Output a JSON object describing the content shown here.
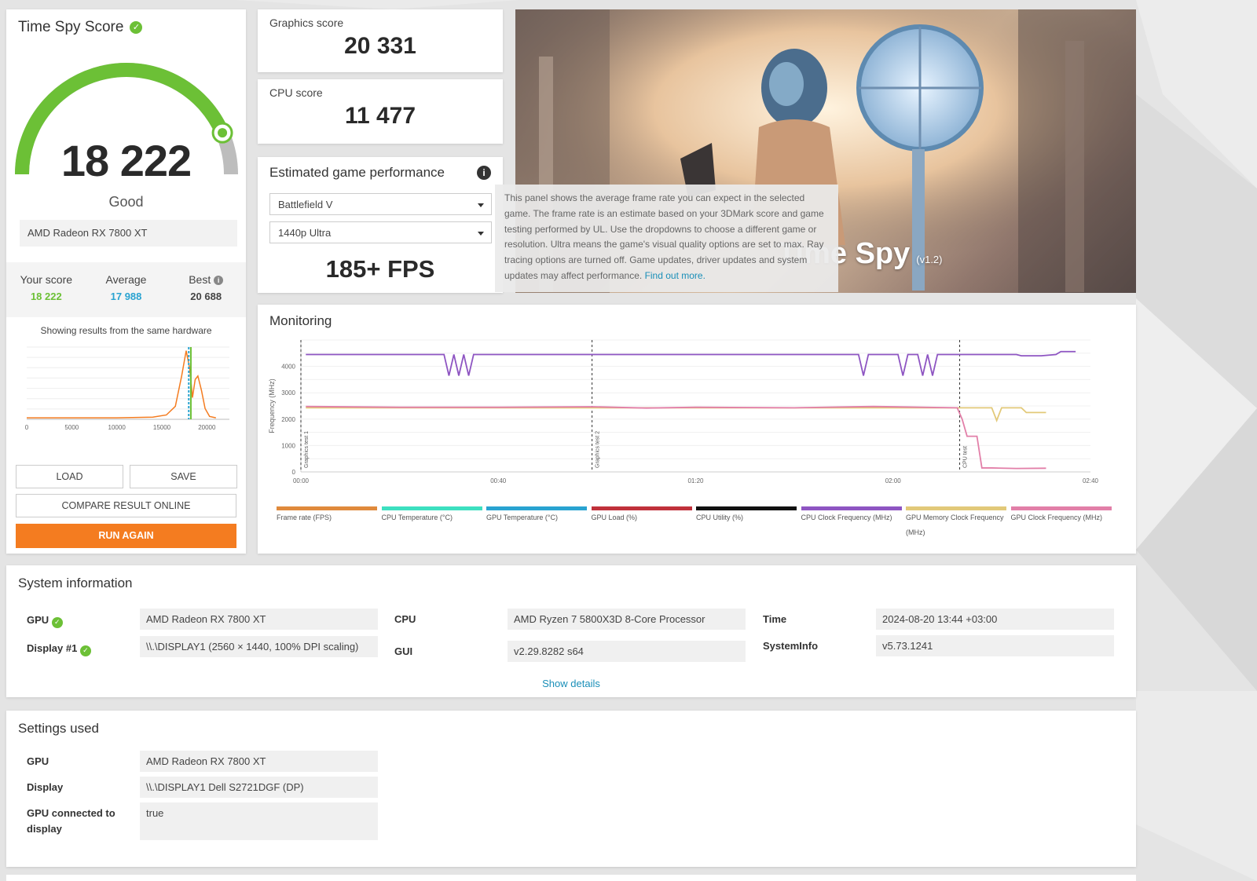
{
  "score_card": {
    "title": "Time Spy Score",
    "score": "18 222",
    "score_value": 18222,
    "rating": "Good",
    "gpu": "AMD Radeon RX 7800 XT",
    "your_score_label": "Your score",
    "your_score": "18 222",
    "average_label": "Average",
    "average": "17 988",
    "best_label": "Best",
    "best": "20 688",
    "showing_text": "Showing results from the same hardware",
    "colors": {
      "good_green": "#6cc036",
      "average_blue": "#29a3d1",
      "accent_orange": "#f47c20"
    }
  },
  "distribution_chart": {
    "type": "line",
    "x_ticks": [
      "0",
      "5000",
      "10000",
      "15000",
      "20000"
    ],
    "xlim": [
      0,
      22500
    ],
    "series": [
      {
        "color": "#f47c20",
        "points": [
          [
            0,
            0.02
          ],
          [
            5000,
            0.02
          ],
          [
            10000,
            0.02
          ],
          [
            14000,
            0.03
          ],
          [
            15500,
            0.06
          ],
          [
            16500,
            0.18
          ],
          [
            17200,
            0.6
          ],
          [
            17700,
            0.95
          ],
          [
            18100,
            0.7
          ],
          [
            18400,
            0.3
          ],
          [
            18700,
            0.55
          ],
          [
            19000,
            0.6
          ],
          [
            19400,
            0.4
          ],
          [
            19800,
            0.15
          ],
          [
            20300,
            0.04
          ],
          [
            21000,
            0.02
          ]
        ]
      }
    ],
    "markers": [
      {
        "x": 17988,
        "color": "#29a3d1",
        "style": "dashed"
      },
      {
        "x": 18222,
        "color": "#6cc036",
        "style": "solid"
      }
    ]
  },
  "buttons": {
    "load": "LOAD",
    "save": "SAVE",
    "compare": "COMPARE RESULT ONLINE",
    "run_again": "RUN AGAIN"
  },
  "graphics_score": {
    "label": "Graphics score",
    "value": "20 331"
  },
  "cpu_score": {
    "label": "CPU score",
    "value": "11 477"
  },
  "estimated_game_performance": {
    "title": "Estimated game performance",
    "game": "Battlefield V",
    "preset": "1440p Ultra",
    "fps": "185+ FPS"
  },
  "tooltip": {
    "text": "This panel shows the average frame rate you can expect in the selected game. The frame rate is an estimate based on your 3DMark score and game testing performed by UL. Use the dropdowns to choose a different game or resolution. Ultra means the game's visual quality options are set to max. Ray tracing options are turned off. Game updates, driver updates and system updates may affect performance.",
    "link": "Find out more."
  },
  "hero": {
    "title": "Time Spy",
    "version": "(v1.2)"
  },
  "monitoring": {
    "title": "Monitoring",
    "chart_data": {
      "type": "line",
      "ylabel": "Frequency (MHz)",
      "y_ticks": [
        "0",
        "1000",
        "2000",
        "3000",
        "4000"
      ],
      "ylim": [
        0,
        5000
      ],
      "x_ticks": [
        "00:00",
        "00:40",
        "01:20",
        "02:00",
        "02:40"
      ],
      "xlim": [
        0,
        160
      ],
      "test_markers": [
        {
          "x": 0,
          "label": "Graphics test 1"
        },
        {
          "x": 59,
          "label": "Graphics test 2"
        },
        {
          "x": 133.5,
          "label": "CPU test"
        }
      ],
      "series": [
        {
          "name": "CPU Clock Frequency (MHz)",
          "color": "#8e55c2",
          "points": [
            [
              1,
              4450
            ],
            [
              29,
              4450
            ],
            [
              30,
              3650
            ],
            [
              31,
              4450
            ],
            [
              32,
              3650
            ],
            [
              33,
              4450
            ],
            [
              34,
              3650
            ],
            [
              35,
              4450
            ],
            [
              37,
              4450
            ],
            [
              113,
              4450
            ],
            [
              114,
              3650
            ],
            [
              115,
              4450
            ],
            [
              121,
              4450
            ],
            [
              122,
              3650
            ],
            [
              123,
              4450
            ],
            [
              125,
              4450
            ],
            [
              126,
              3650
            ],
            [
              127,
              4450
            ],
            [
              128,
              3650
            ],
            [
              129,
              4450
            ],
            [
              145,
              4450
            ],
            [
              146,
              4400
            ],
            [
              150,
              4400
            ],
            [
              153,
              4450
            ],
            [
              154,
              4560
            ],
            [
              157,
              4560
            ]
          ]
        },
        {
          "name": "GPU Memory Clock Frequency (MHz)",
          "color": "#e2c979",
          "points": [
            [
              1,
              2430
            ],
            [
              133,
              2430
            ],
            [
              140,
              2430
            ],
            [
              141,
              1950
            ],
            [
              142,
              2430
            ],
            [
              146,
              2430
            ],
            [
              147,
              2250
            ],
            [
              151,
              2250
            ]
          ]
        },
        {
          "name": "GPU Clock Frequency (MHz)",
          "color": "#e27fa8",
          "points": [
            [
              1,
              2480
            ],
            [
              20,
              2450
            ],
            [
              40,
              2450
            ],
            [
              59,
              2470
            ],
            [
              70,
              2420
            ],
            [
              80,
              2450
            ],
            [
              100,
              2430
            ],
            [
              116,
              2480
            ],
            [
              133,
              2430
            ],
            [
              134,
              2000
            ],
            [
              135,
              1350
            ],
            [
              137,
              1350
            ],
            [
              138,
              150
            ],
            [
              140,
              150
            ],
            [
              145,
              130
            ],
            [
              151,
              140
            ]
          ]
        }
      ]
    },
    "legend": [
      {
        "label": "Frame rate (FPS)",
        "color": "#e08a3c"
      },
      {
        "label": "CPU Temperature (°C)",
        "color": "#3de0c0"
      },
      {
        "label": "GPU Temperature (°C)",
        "color": "#29a3d1"
      },
      {
        "label": "GPU Load (%)",
        "color": "#c0313b"
      },
      {
        "label": "CPU Utility (%)",
        "color": "#111111"
      },
      {
        "label": "CPU Clock Frequency (MHz)",
        "color": "#8e55c2"
      },
      {
        "label": "GPU Memory Clock Frequency (MHz)",
        "color": "#e2c979"
      },
      {
        "label": "GPU Clock Frequency (MHz)",
        "color": "#e27fa8"
      }
    ]
  },
  "system_information": {
    "title": "System information",
    "gpu_label": "GPU",
    "gpu": "AMD Radeon RX 7800 XT",
    "display_label": "Display #1",
    "display": "\\\\.\\DISPLAY1 (2560 × 1440, 100% DPI scaling)",
    "cpu_label": "CPU",
    "cpu": "AMD Ryzen 7 5800X3D 8-Core Processor",
    "gui_label": "GUI",
    "gui": "v2.29.8282 s64",
    "time_label": "Time",
    "time": "2024-08-20 13:44 +03:00",
    "systeminfo_label": "SystemInfo",
    "systeminfo": "v5.73.1241",
    "show_details": "Show details"
  },
  "settings_used": {
    "title": "Settings used",
    "gpu_label": "GPU",
    "gpu": "AMD Radeon RX 7800 XT",
    "display_label": "Display",
    "display": "\\\\.\\DISPLAY1 Dell S2721DGF (DP)",
    "gpu_connected_label_line1": "GPU connected to",
    "gpu_connected_label_line2": "display",
    "gpu_connected": "true"
  }
}
